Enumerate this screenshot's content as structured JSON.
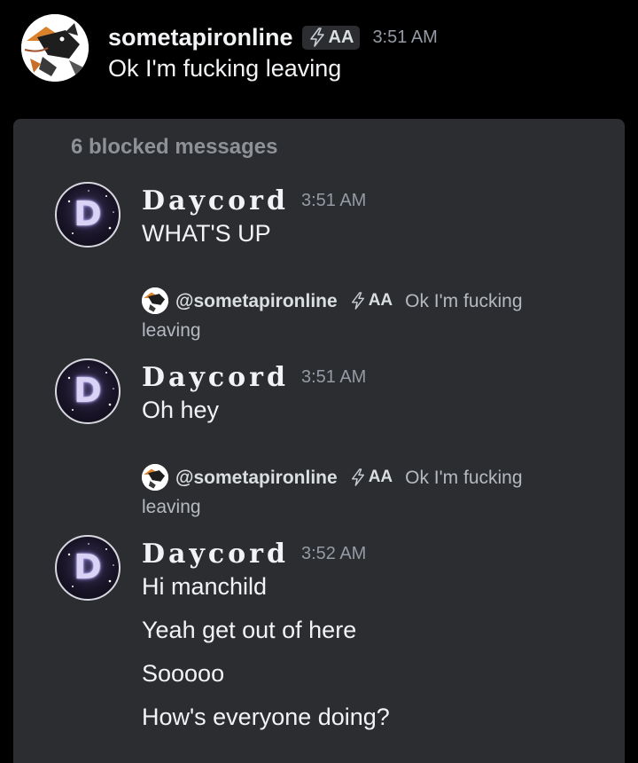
{
  "top_message": {
    "username": "sometapironline",
    "tag": "AA",
    "time": "3:51 AM",
    "text": "Ok I'm fucking leaving"
  },
  "blocked": {
    "label": "6 blocked messages",
    "messages": [
      {
        "username": "Daycord",
        "time": "3:51 AM",
        "lines": [
          "WHAT'S UP"
        ]
      },
      {
        "reply": {
          "username": "@sometapironline",
          "tag": "AA",
          "text_start": "Ok I'm fucking",
          "text_end": "leaving"
        },
        "username": "Daycord",
        "time": "3:51 AM",
        "lines": [
          "Oh hey"
        ]
      },
      {
        "reply": {
          "username": "@sometapironline",
          "tag": "AA",
          "text_start": "Ok I'm fucking",
          "text_end": "leaving"
        },
        "username": "Daycord",
        "time": "3:52 AM",
        "lines": [
          "Hi manchild",
          "Yeah get out of here",
          "Sooooo",
          "How's everyone doing?"
        ]
      }
    ]
  },
  "colors": {
    "background": "#000000",
    "panel": "#2b2d31",
    "text": "#f2f3f5",
    "muted": "#949ba4"
  },
  "icons": [
    "tapir-avatar",
    "daycord-avatar",
    "lightning-icon"
  ]
}
